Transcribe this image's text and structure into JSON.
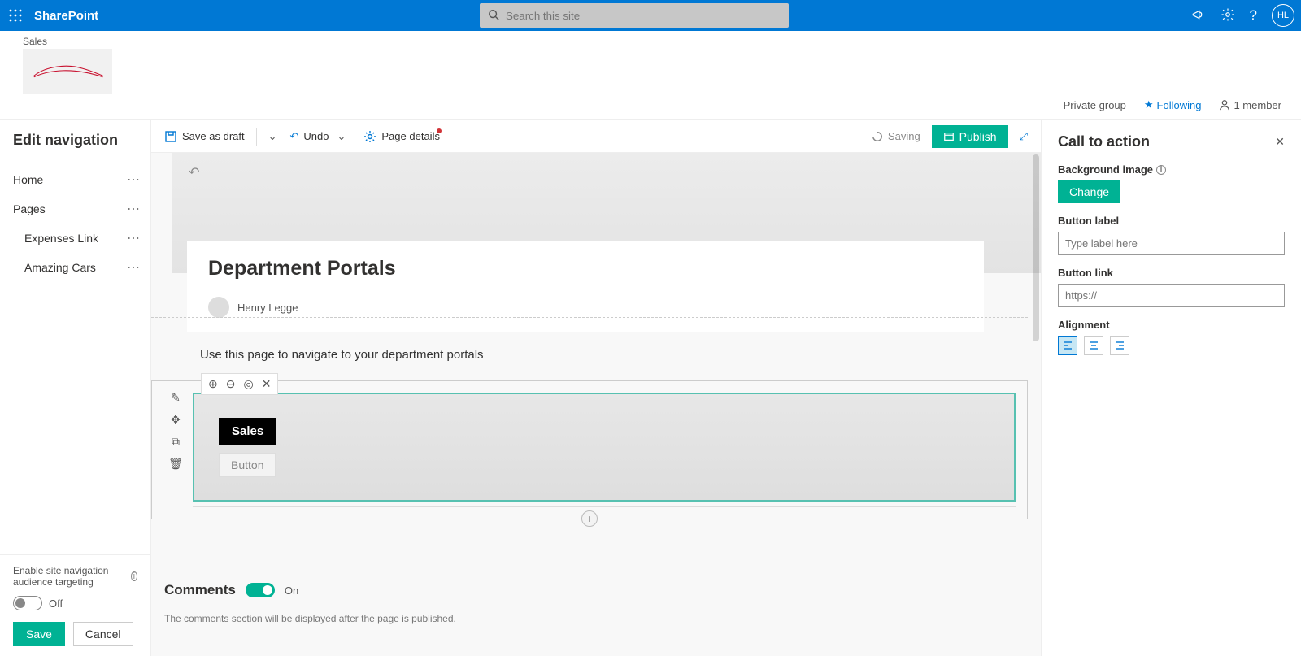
{
  "suite": {
    "app_name": "SharePoint",
    "search_placeholder": "Search this site",
    "user_initials": "HL"
  },
  "site": {
    "name": "Sales",
    "privacy": "Private group",
    "following": "Following",
    "members": "1 member"
  },
  "leftnav": {
    "title": "Edit navigation",
    "items": {
      "home": "Home",
      "pages": "Pages",
      "expenses": "Expenses Link",
      "amazing": "Amazing Cars"
    },
    "audience_label": "Enable site navigation audience targeting",
    "toggle_state": "Off",
    "save": "Save",
    "cancel": "Cancel"
  },
  "cmdbar": {
    "save_as_draft": "Save as draft",
    "undo": "Undo",
    "page_details": "Page details",
    "saving": "Saving",
    "publish": "Publish"
  },
  "page": {
    "title": "Department Portals",
    "author": "Henry Legge",
    "intro": "Use this page to navigate to your department portals",
    "cta_pill": "Sales",
    "cta_button_ph": "Button"
  },
  "comments": {
    "heading": "Comments",
    "state": "On",
    "note": "The comments section will be displayed after the page is published."
  },
  "props": {
    "title": "Call to action",
    "bg_label": "Background image",
    "change": "Change",
    "btn_label_heading": "Button label",
    "btn_label_ph": "Type label here",
    "btn_link_heading": "Button link",
    "btn_link_ph": "https://",
    "alignment_heading": "Alignment"
  }
}
